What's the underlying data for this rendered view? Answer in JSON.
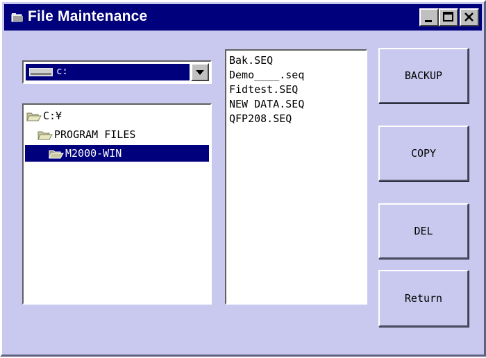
{
  "window": {
    "title": "File Maintenance",
    "app_icon": "folder-app-icon",
    "controls": [
      "minimize-icon",
      "maximize-icon",
      "close-icon"
    ],
    "colors": {
      "titlebar": "#00007c",
      "body": "#c9c9f0",
      "selection": "#00007c"
    }
  },
  "drive_select": {
    "value": "c:",
    "icon": "drive-icon"
  },
  "folder_tree": {
    "nodes": [
      {
        "label": "C:¥",
        "icon": "open-folder-icon"
      },
      {
        "label": "PROGRAM FILES",
        "icon": "open-folder-icon"
      },
      {
        "label": "M2000-WIN",
        "icon": "open-folder-icon",
        "selected": true
      }
    ]
  },
  "file_list": {
    "items": [
      "Bak.SEQ",
      "Demo____.seq",
      "Fidtest.SEQ",
      "NEW DATA.SEQ",
      "QFP208.SEQ"
    ]
  },
  "buttons": {
    "backup": "BACKUP",
    "copy": "COPY",
    "del": "DEL",
    "return": "Return"
  }
}
